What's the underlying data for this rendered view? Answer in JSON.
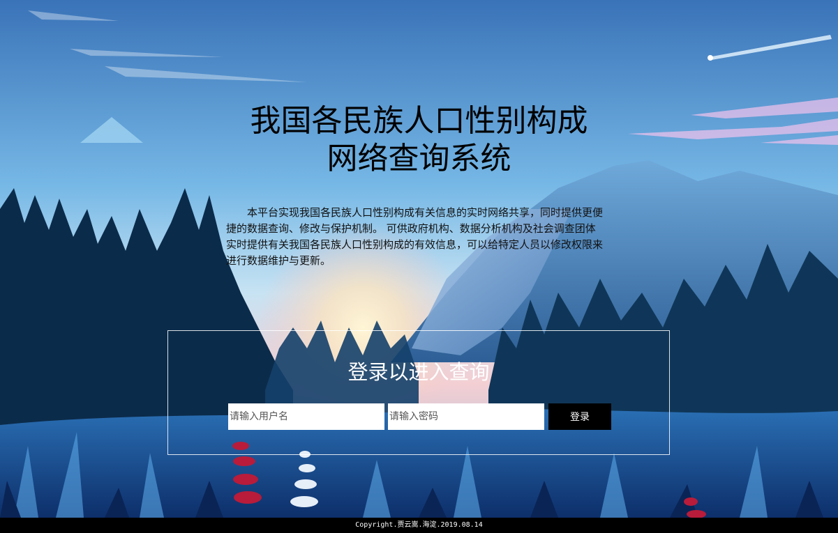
{
  "page": {
    "title_line1": "我国各民族人口性别构成",
    "title_line2": "网络查询系统",
    "intro": "本平台实现我国各民族人口性别构成有关信息的实时网络共享，同时提供更便捷的数据查询、修改与保护机制。 可供政府机构、数据分析机构及社会调查团体实时提供有关我国各民族人口性别构成的有效信息，可以给特定人员以修改权限来进行数据维护与更新。"
  },
  "login": {
    "heading": "登录以进入查询",
    "username_placeholder": "请输入用户名",
    "password_placeholder": "请输入密码",
    "button_label": "登录"
  },
  "footer": {
    "copyright": "Copyright.贾云嵩.海淀.2019.08.14"
  },
  "colors": {
    "sky_top": "#3f7bbf",
    "sky_mid": "#7fc0ec",
    "horizon_glow": "#f6c9c4",
    "forest_dark": "#0b2b4a",
    "footer_bg": "#000000",
    "button_bg": "#000000"
  }
}
